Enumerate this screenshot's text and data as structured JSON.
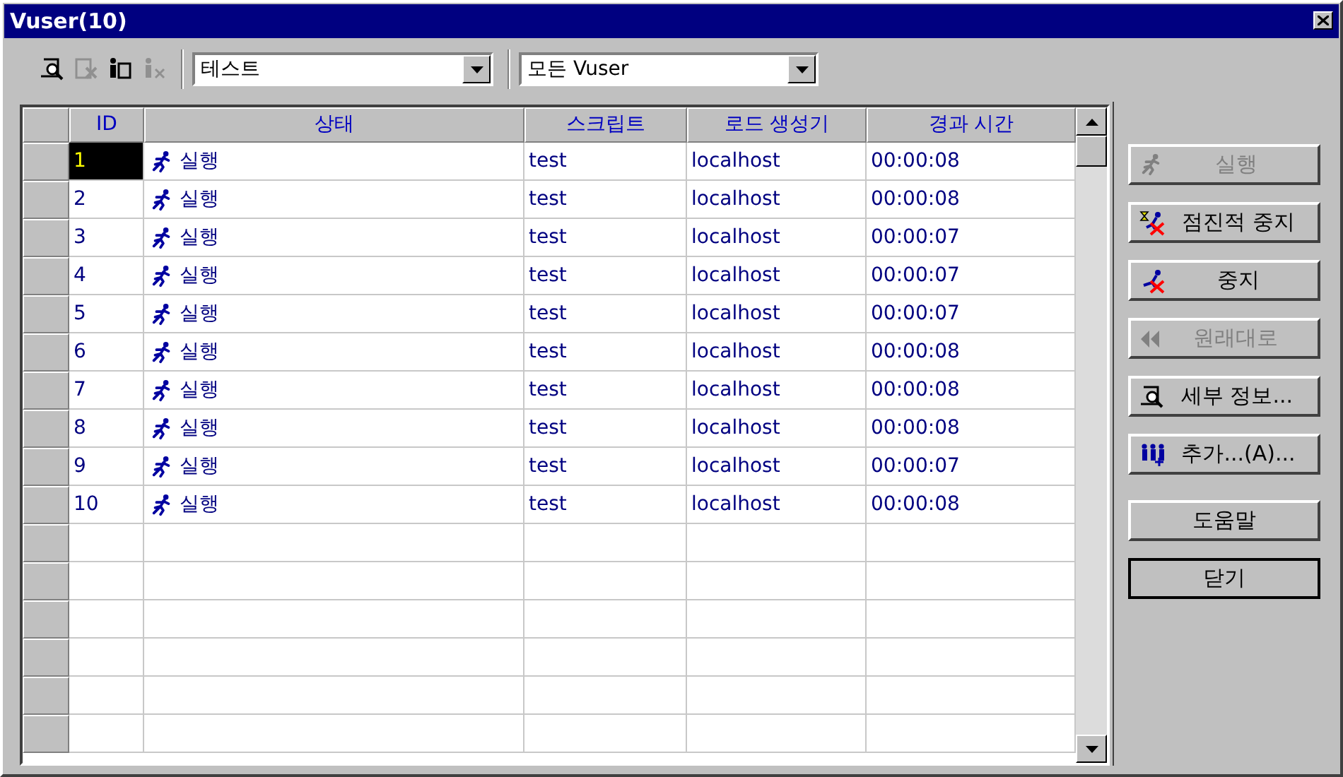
{
  "window": {
    "title": "Vuser(10)"
  },
  "toolbar": {
    "icons": [
      {
        "kind": "details",
        "disabled": false
      },
      {
        "kind": "remove",
        "disabled": true
      },
      {
        "kind": "info",
        "disabled": false
      },
      {
        "kind": "reset",
        "disabled": true
      }
    ],
    "group_filter": {
      "value": "테스트"
    },
    "vuser_filter": {
      "value": "모든 Vuser"
    }
  },
  "table": {
    "columns": [
      "ID",
      "상태",
      "스크립트",
      "로드 생성기",
      "경과 시간"
    ],
    "rows": [
      {
        "id": "1",
        "status": "실행",
        "script": "test",
        "generator": "localhost",
        "elapsed": "00:00:08",
        "selected": true
      },
      {
        "id": "2",
        "status": "실행",
        "script": "test",
        "generator": "localhost",
        "elapsed": "00:00:08",
        "selected": false
      },
      {
        "id": "3",
        "status": "실행",
        "script": "test",
        "generator": "localhost",
        "elapsed": "00:00:07",
        "selected": false
      },
      {
        "id": "4",
        "status": "실행",
        "script": "test",
        "generator": "localhost",
        "elapsed": "00:00:07",
        "selected": false
      },
      {
        "id": "5",
        "status": "실행",
        "script": "test",
        "generator": "localhost",
        "elapsed": "00:00:07",
        "selected": false
      },
      {
        "id": "6",
        "status": "실행",
        "script": "test",
        "generator": "localhost",
        "elapsed": "00:00:08",
        "selected": false
      },
      {
        "id": "7",
        "status": "실행",
        "script": "test",
        "generator": "localhost",
        "elapsed": "00:00:08",
        "selected": false
      },
      {
        "id": "8",
        "status": "실행",
        "script": "test",
        "generator": "localhost",
        "elapsed": "00:00:08",
        "selected": false
      },
      {
        "id": "9",
        "status": "실행",
        "script": "test",
        "generator": "localhost",
        "elapsed": "00:00:07",
        "selected": false
      },
      {
        "id": "10",
        "status": "실행",
        "script": "test",
        "generator": "localhost",
        "elapsed": "00:00:08",
        "selected": false
      }
    ]
  },
  "buttons": [
    {
      "label": "실행",
      "kind": "run",
      "disabled": true
    },
    {
      "label": "점진적 중지",
      "kind": "gradual-stop",
      "disabled": false
    },
    {
      "label": "중지",
      "kind": "stop",
      "disabled": false
    },
    {
      "label": "원래대로",
      "kind": "reset",
      "disabled": true
    },
    {
      "label": "세부 정보...",
      "kind": "details",
      "disabled": false
    },
    {
      "label": "추가...(A)...",
      "kind": "add",
      "disabled": false
    },
    {
      "label": "도움말",
      "kind": "help",
      "disabled": false
    },
    {
      "label": "닫기",
      "kind": "close",
      "disabled": false
    }
  ]
}
